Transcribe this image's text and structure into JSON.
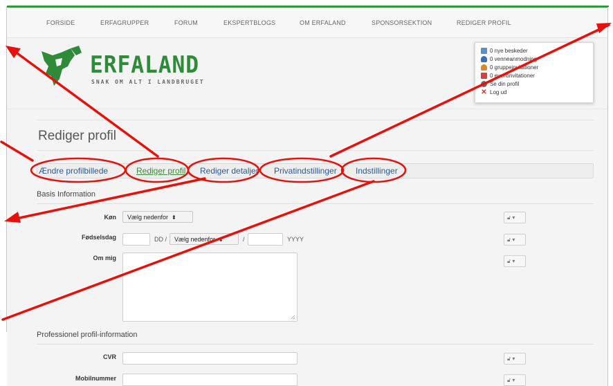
{
  "nav": {
    "items": [
      "FORSIDE",
      "ERFAGRUPPER",
      "FORUM",
      "EKSPERTBLOGS",
      "OM ERFALAND",
      "SPONSORSEKTION",
      "REDIGER PROFIL"
    ]
  },
  "logo": {
    "title": "ERFALAND",
    "subtitle": "SNAK OM ALT I LANDBRUGET"
  },
  "user_menu": {
    "items": [
      "0 nye beskeder",
      "0 venneanmodning",
      "0 gruppeinvitationer",
      "0 eventinvitationer",
      "Se din profil",
      "Log ud"
    ]
  },
  "page": {
    "title": "Rediger profil"
  },
  "tabs": {
    "items": [
      "Ændre profilbillede",
      "Rediger profil",
      "Rediger detaljer",
      "Privatindstillinger",
      "Indstillinger"
    ]
  },
  "form": {
    "basis_title": "Basis Information",
    "gender_label": "Køn",
    "gender_value": "Vælg nedenfor",
    "birthday_label": "Fødselsdag",
    "day_hint": "DD /",
    "month_value": "Vælg nedenfor",
    "slash": "/",
    "year_hint": "YYYY",
    "about_label": "Om mig",
    "pro_title": "Professionel profil-information",
    "cvr_label": "CVR",
    "mobile_label": "Mobilnummer"
  },
  "colors": {
    "brand_green": "#2f8a3a",
    "tab_link": "#2a5a98",
    "annotation_red": "#e8100a"
  }
}
